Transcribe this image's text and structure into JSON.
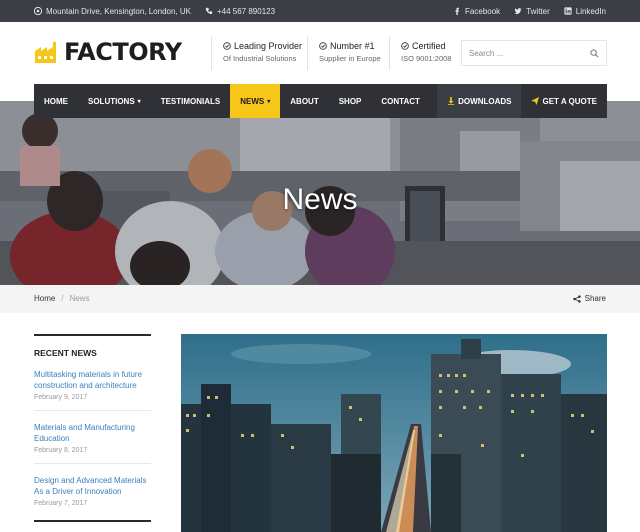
{
  "topbar": {
    "address": "Mountain Drive, Kensington, London, UK",
    "phone": "+44 567 890123",
    "social": [
      "Facebook",
      "Twitter",
      "LinkedIn"
    ]
  },
  "brand": {
    "name": "FACTORY",
    "accent": "#f6c618"
  },
  "header_info": [
    {
      "title": "Leading Provider",
      "subtitle": "Of Industrial Solutions"
    },
    {
      "title": "Number #1",
      "subtitle": "Supplier in Europe"
    },
    {
      "title": "Certified",
      "subtitle": "ISO 9001:2008"
    }
  ],
  "search": {
    "placeholder": "Search ..."
  },
  "nav": {
    "items": [
      "HOME",
      "SOLUTIONS",
      "TESTIMONIALS",
      "NEWS",
      "ABOUT",
      "SHOP",
      "CONTACT"
    ],
    "active": "NEWS",
    "downloads": "DOWNLOADS",
    "quote": "GET A QUOTE"
  },
  "hero": {
    "title": "News"
  },
  "breadcrumb": {
    "home": "Home",
    "current": "News",
    "share": "Share"
  },
  "sidebar": {
    "heading": "RECENT NEWS",
    "posts": [
      {
        "title": "Multitasking materials in future construction and architecture",
        "date": "February 9, 2017"
      },
      {
        "title": "Materials and Manufacturing Education",
        "date": "February 8, 2017"
      },
      {
        "title": "Design and Advanced Materials As a Driver of Innovation",
        "date": "February 7, 2017"
      }
    ]
  }
}
